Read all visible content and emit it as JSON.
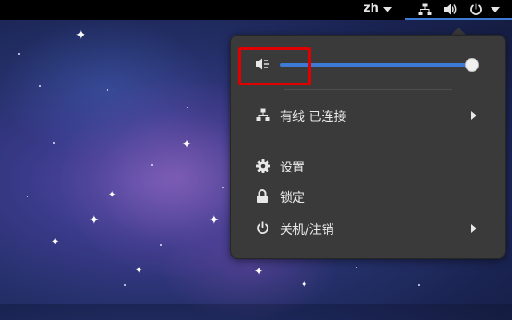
{
  "topbar": {
    "language": "zh",
    "icons": [
      "network-wired-icon",
      "volume-icon",
      "power-icon"
    ]
  },
  "menu": {
    "volume": {
      "level": 1.0,
      "icon": "volume-muted-icon"
    },
    "network": {
      "label": "有线 已连接",
      "icon": "network-wired-icon"
    },
    "settings": {
      "label": "设置",
      "icon": "gear-icon"
    },
    "lock": {
      "label": "锁定",
      "icon": "lock-icon"
    },
    "power": {
      "label": "关机/注销",
      "icon": "power-icon"
    }
  },
  "colors": {
    "accent": "#3d7ad4",
    "highlight": "#e00000",
    "menu_bg": "#3a3a3a"
  }
}
